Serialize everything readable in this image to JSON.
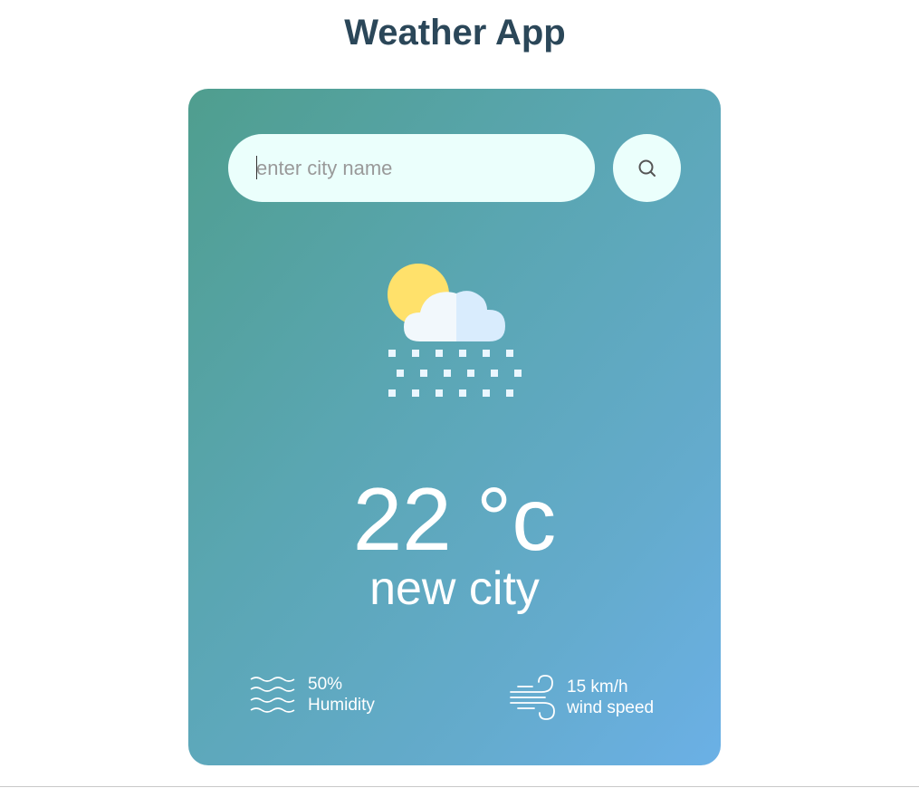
{
  "page": {
    "title": "Weather App"
  },
  "search": {
    "placeholder": "enter city name",
    "value": ""
  },
  "icons": {
    "search": "search-icon",
    "weather": "sun-cloud-snow-icon",
    "humidity": "waves-icon",
    "wind": "wind-icon"
  },
  "weather": {
    "temperature": "22 °c",
    "city": "new city"
  },
  "stats": {
    "humidity_value": "50%",
    "humidity_label": "Humidity",
    "wind_value": "15 km/h",
    "wind_label": "wind speed"
  },
  "colors": {
    "title": "#2b4759",
    "card_gradient_start": "#4f9e8e",
    "card_gradient_end": "#6bb0e6",
    "input_bg": "#ebfffc",
    "sun": "#ffe16b",
    "cloud_light": "#f2f8fc",
    "cloud_shade": "#d9ecfd",
    "snow": "#eaf6ff"
  }
}
